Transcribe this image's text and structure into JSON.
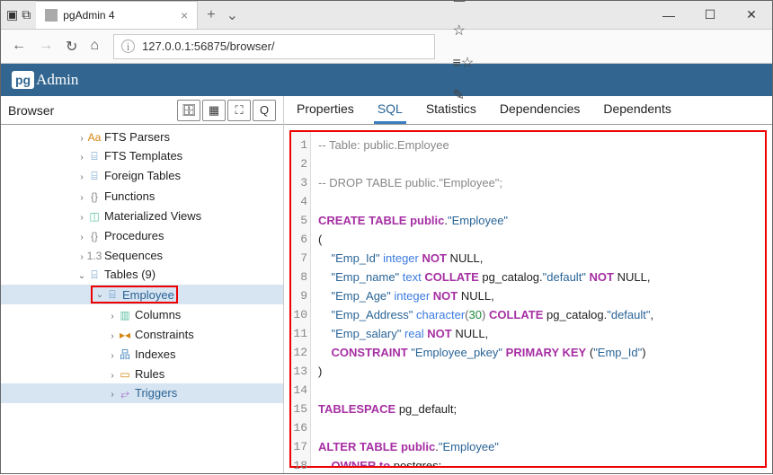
{
  "browser": {
    "tab_title": "pgAdmin 4",
    "url": "127.0.0.1:56875/browser/"
  },
  "pgadmin": {
    "brand_prefix": "pg",
    "brand_rest": "Admin"
  },
  "sidebar": {
    "title": "Browser",
    "items": [
      {
        "arrow": "›",
        "icon": "Aa",
        "icon_class": "c-orange",
        "label": "FTS Parsers",
        "indent": "ind1"
      },
      {
        "arrow": "›",
        "icon": "⌸",
        "icon_class": "c-blue",
        "label": "FTS Templates",
        "indent": "ind1"
      },
      {
        "arrow": "›",
        "icon": "⌸",
        "icon_class": "c-blue",
        "label": "Foreign Tables",
        "indent": "ind1"
      },
      {
        "arrow": "›",
        "icon": "{}",
        "icon_class": "c-gray",
        "label": "Functions",
        "indent": "ind1"
      },
      {
        "arrow": "›",
        "icon": "◫",
        "icon_class": "c-teal",
        "label": "Materialized Views",
        "indent": "ind1"
      },
      {
        "arrow": "›",
        "icon": "{}",
        "icon_class": "c-gray",
        "label": "Procedures",
        "indent": "ind1"
      },
      {
        "arrow": "›",
        "icon": "1.3",
        "icon_class": "c-gray",
        "label": "Sequences",
        "indent": "ind1"
      },
      {
        "arrow": "⌄",
        "icon": "⌸",
        "icon_class": "c-blue",
        "label": "Tables (9)",
        "indent": "ind1"
      },
      {
        "arrow": "⌄",
        "icon": "⌸",
        "icon_class": "c-blue",
        "label": "Employee",
        "indent": "ind2",
        "selected": true,
        "redbox": true
      },
      {
        "arrow": "›",
        "icon": "▥",
        "icon_class": "c-teal",
        "label": "Columns",
        "indent": "ind3"
      },
      {
        "arrow": "›",
        "icon": "▸◂",
        "icon_class": "c-orange",
        "label": "Constraints",
        "indent": "ind3"
      },
      {
        "arrow": "›",
        "icon": "品",
        "icon_class": "c-blue",
        "label": "Indexes",
        "indent": "ind3"
      },
      {
        "arrow": "›",
        "icon": "▭",
        "icon_class": "c-orange",
        "label": "Rules",
        "indent": "ind3"
      },
      {
        "arrow": "›",
        "icon": "⥂",
        "icon_class": "c-purple",
        "label": "Triggers",
        "indent": "ind3",
        "selected": true
      }
    ]
  },
  "tabs": {
    "items": [
      "Properties",
      "SQL",
      "Statistics",
      "Dependencies",
      "Dependents"
    ],
    "active_index": 1
  },
  "code": {
    "line_count": 18,
    "lines": [
      [
        {
          "c": "cm",
          "t": "-- Table: public.Employee"
        }
      ],
      [],
      [
        {
          "c": "cm",
          "t": "-- DROP TABLE public.\"Employee\";"
        }
      ],
      [],
      [
        {
          "c": "kw",
          "t": "CREATE TABLE"
        },
        {
          "t": " "
        },
        {
          "c": "kw2",
          "t": "public"
        },
        {
          "t": "."
        },
        {
          "c": "s",
          "t": "\"Employee\""
        }
      ],
      [
        {
          "t": "("
        }
      ],
      [
        {
          "t": "    "
        },
        {
          "c": "s",
          "t": "\"Emp_Id\""
        },
        {
          "t": " "
        },
        {
          "c": "fn",
          "t": "integer"
        },
        {
          "t": " "
        },
        {
          "c": "kw",
          "t": "NOT"
        },
        {
          "t": " NULL,"
        }
      ],
      [
        {
          "t": "    "
        },
        {
          "c": "s",
          "t": "\"Emp_name\""
        },
        {
          "t": " "
        },
        {
          "c": "fn",
          "t": "text"
        },
        {
          "t": " "
        },
        {
          "c": "kw",
          "t": "COLLATE"
        },
        {
          "t": " pg_catalog."
        },
        {
          "c": "s",
          "t": "\"default\""
        },
        {
          "t": " "
        },
        {
          "c": "kw",
          "t": "NOT"
        },
        {
          "t": " NULL,"
        }
      ],
      [
        {
          "t": "    "
        },
        {
          "c": "s",
          "t": "\"Emp_Age\""
        },
        {
          "t": " "
        },
        {
          "c": "fn",
          "t": "integer"
        },
        {
          "t": " "
        },
        {
          "c": "kw",
          "t": "NOT"
        },
        {
          "t": " NULL,"
        }
      ],
      [
        {
          "t": "    "
        },
        {
          "c": "s",
          "t": "\"Emp_Address\""
        },
        {
          "t": " "
        },
        {
          "c": "fn",
          "t": "character"
        },
        {
          "c": "p",
          "t": "("
        },
        {
          "c": "num",
          "t": "30"
        },
        {
          "c": "p",
          "t": ")"
        },
        {
          "t": " "
        },
        {
          "c": "kw",
          "t": "COLLATE"
        },
        {
          "t": " pg_catalog."
        },
        {
          "c": "s",
          "t": "\"default\""
        },
        {
          "t": ","
        }
      ],
      [
        {
          "t": "    "
        },
        {
          "c": "s",
          "t": "\"Emp_salary\""
        },
        {
          "t": " "
        },
        {
          "c": "fn",
          "t": "real"
        },
        {
          "t": " "
        },
        {
          "c": "kw",
          "t": "NOT"
        },
        {
          "t": " NULL,"
        }
      ],
      [
        {
          "t": "    "
        },
        {
          "c": "kw",
          "t": "CONSTRAINT"
        },
        {
          "t": " "
        },
        {
          "c": "s",
          "t": "\"Employee_pkey\""
        },
        {
          "t": " "
        },
        {
          "c": "kw",
          "t": "PRIMARY KEY"
        },
        {
          "t": " ("
        },
        {
          "c": "s",
          "t": "\"Emp_Id\""
        },
        {
          "t": ")"
        }
      ],
      [
        {
          "t": ")"
        }
      ],
      [],
      [
        {
          "c": "kw",
          "t": "TABLESPACE"
        },
        {
          "t": " pg_default;"
        }
      ],
      [],
      [
        {
          "c": "kw",
          "t": "ALTER TABLE"
        },
        {
          "t": " "
        },
        {
          "c": "kw2",
          "t": "public"
        },
        {
          "t": "."
        },
        {
          "c": "s",
          "t": "\"Employee\""
        }
      ],
      [
        {
          "t": "    "
        },
        {
          "c": "kw",
          "t": "OWNER to"
        },
        {
          "t": " postgres;"
        }
      ]
    ]
  }
}
